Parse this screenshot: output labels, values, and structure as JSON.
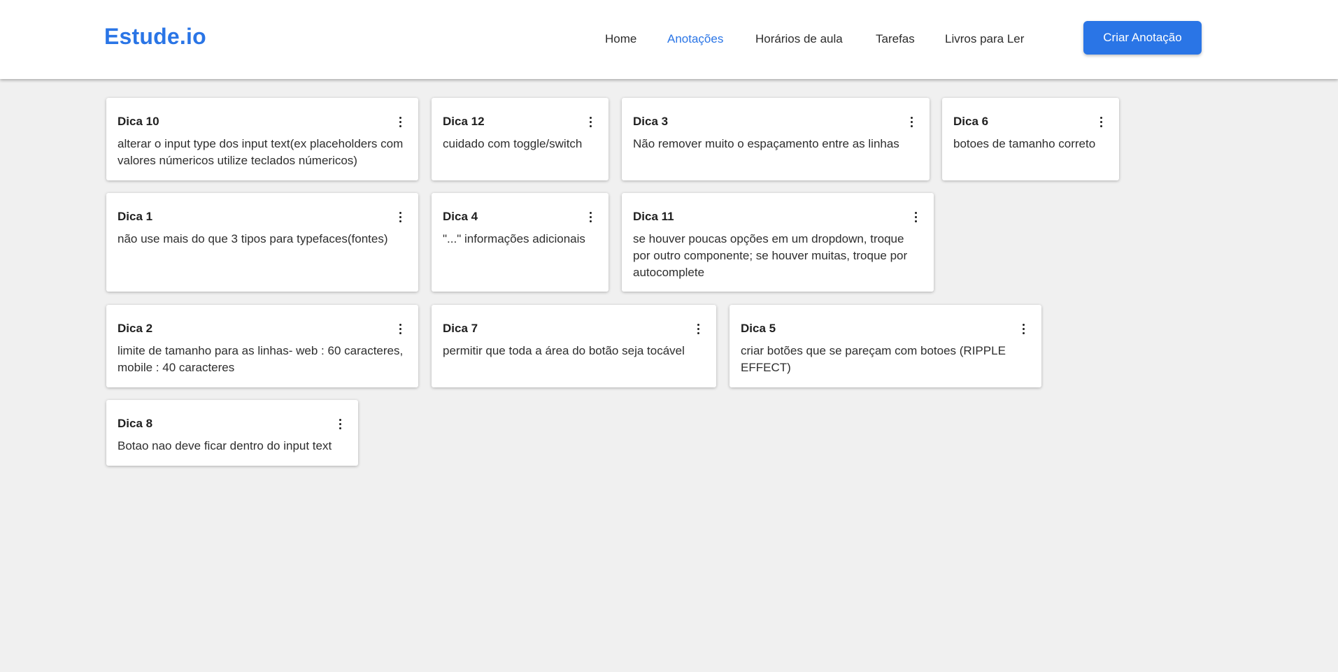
{
  "brand": "Estude.io",
  "nav": {
    "links": [
      "Home",
      "Anotações",
      "Horários de aula",
      "Tarefas",
      "Livros para Ler"
    ],
    "active_link": "Anotações",
    "create_button": "Criar Anotação"
  },
  "colors": {
    "accent": "#2a75e6",
    "background": "#f0f0f0",
    "card": "#ffffff"
  },
  "cards": [
    {
      "title": "Dica 10",
      "body": "alterar o input type dos input text(ex placeholders com valores númericos utilize teclados númericos)",
      "menu_icon": "more-vertical-icon"
    },
    {
      "title": "Dica 12",
      "body": "cuidado com toggle/switch",
      "menu_icon": "more-vertical-icon"
    },
    {
      "title": "Dica 3",
      "body": "Não remover muito o espaçamento entre as linhas",
      "menu_icon": "more-vertical-icon"
    },
    {
      "title": "Dica 6",
      "body": "botoes de tamanho correto",
      "menu_icon": "more-vertical-icon"
    },
    {
      "title": "Dica 1",
      "body": "não use mais do que 3 tipos para typefaces(fontes)",
      "menu_icon": "more-vertical-icon"
    },
    {
      "title": "Dica 4",
      "body": "\"...\" informações adicionais",
      "menu_icon": "more-vertical-icon"
    },
    {
      "title": "Dica 11",
      "body": "se houver poucas opções em um dropdown, troque por outro componente; se houver muitas, troque por autocomplete",
      "menu_icon": "more-vertical-icon"
    },
    {
      "title": "Dica 2",
      "body": "limite de tamanho para as linhas- web : 60 caracteres, mobile : 40 caracteres",
      "menu_icon": "more-vertical-icon"
    },
    {
      "title": "Dica 7",
      "body": "permitir que toda a área do botão seja tocável",
      "menu_icon": "more-vertical-icon"
    },
    {
      "title": "Dica 5",
      "body": "criar botões que se pareçam com botoes (RIPPLE EFFECT)",
      "menu_icon": "more-vertical-icon"
    },
    {
      "title": "Dica 8",
      "body": "Botao nao deve ficar dentro do input text",
      "menu_icon": "more-vertical-icon"
    }
  ]
}
